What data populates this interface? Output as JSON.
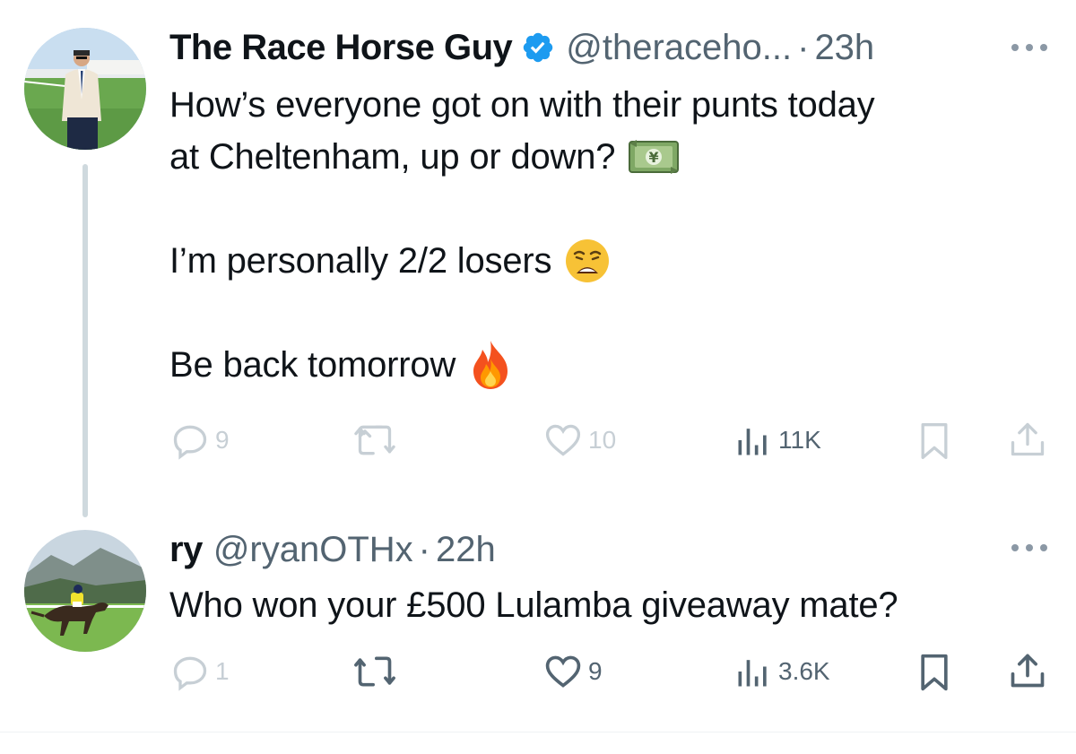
{
  "tweets": [
    {
      "display_name": "The Race Horse Guy",
      "verified": true,
      "handle": "@theraceho...",
      "separator": "·",
      "time": "23h",
      "text_lines": [
        "How’s everyone got on with their punts today",
        "at Cheltenham, up or down?",
        "I’m personally 2/2 losers",
        "Be back tomorrow"
      ],
      "emojis": [
        "money-with-wings-emoji",
        "weary-face-emoji",
        "fire-emoji"
      ],
      "stats": {
        "replies": "9",
        "likes": "10",
        "views": "11K"
      }
    },
    {
      "display_name": "ry",
      "verified": false,
      "handle": "@ryanOTHx",
      "separator": "·",
      "time": "22h",
      "text_lines": [
        "Who won your £500 Lulamba giveaway mate?"
      ],
      "stats": {
        "replies": "1",
        "likes": "9",
        "views": "3.6K"
      }
    }
  ],
  "colors": {
    "text": "#0f1419",
    "secondary": "#536471",
    "faded_icon": "#c7cfd5",
    "verified_blue": "#1d9bf0",
    "thread_line": "#cfd9de"
  }
}
